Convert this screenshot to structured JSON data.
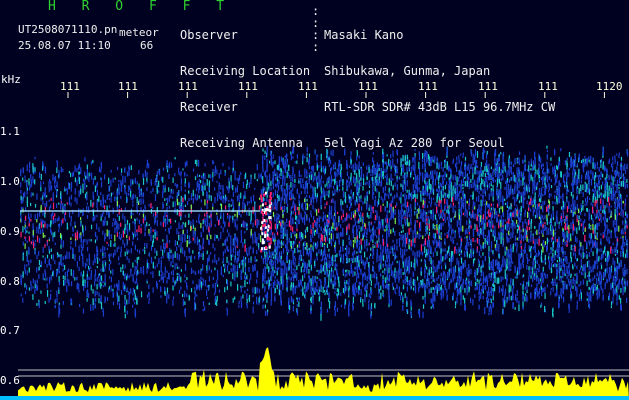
{
  "header": {
    "logo": "H R O F F T",
    "filename": "UT2508071110.pn",
    "meteor_label": "meteor",
    "timestamp": "25.08.07 11:10",
    "count": "66"
  },
  "station_info": {
    "labels": [
      "Observer",
      "Receiving Location",
      "Receiver",
      "Receiving Antenna"
    ],
    "values": [
      "Masaki Kano",
      "Shibukawa, Gunma, Japan",
      "RTL-SDR SDR# 43dB L15 96.7MHz CW",
      "5el Yagi Az 280 for Seoul"
    ]
  },
  "axes": {
    "y_unit": "kHz",
    "y_ticks": [
      "1.1",
      "1.0",
      "0.9",
      "0.8",
      "0.7",
      "0.6"
    ],
    "x_ticks": [
      "111",
      "111",
      "111",
      "111",
      "111",
      "111",
      "111",
      "111",
      "111",
      "1120"
    ]
  },
  "colors": {
    "background": "#000020",
    "noise": "#1b3fd0",
    "mid": "#19c8c8",
    "hot": "#ff2070",
    "grid": "#ffffff",
    "amplitude": "#ffff00",
    "baseline": "#00bfff"
  }
}
